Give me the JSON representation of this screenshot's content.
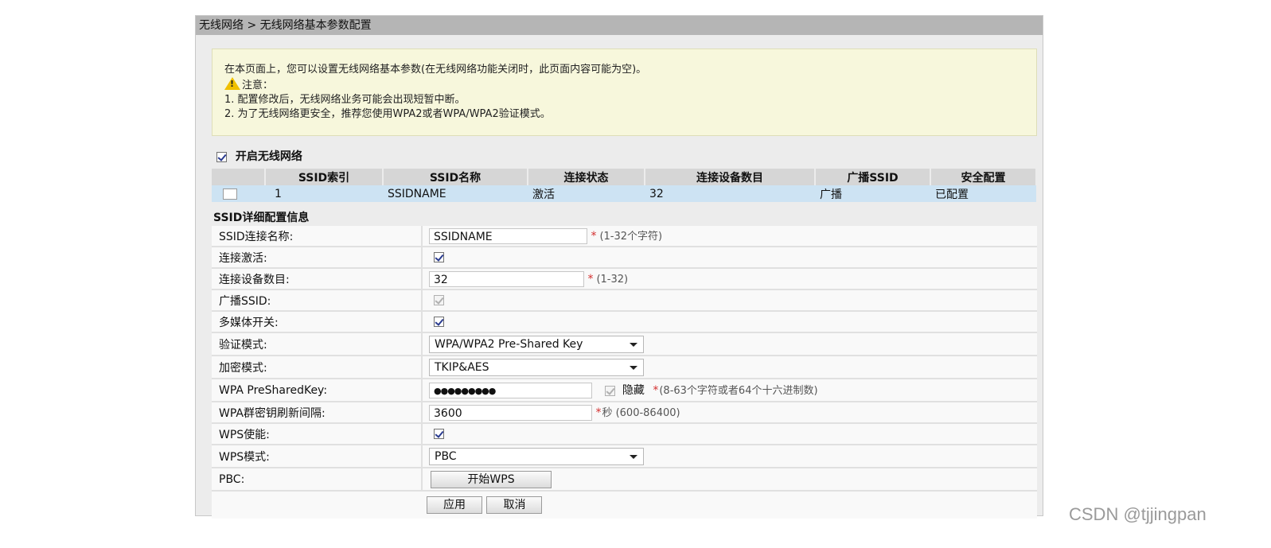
{
  "breadcrumb": "无线网络 > 无线网络基本参数配置",
  "notice": {
    "line1": "在本页面上，您可以设置无线网络基本参数(在无线网络功能关闭时，此页面内容可能为空)。",
    "warning_title": "注意：",
    "item1": "1. 配置修改后，无线网络业务可能会出现短暂中断。",
    "item2": "2. 为了无线网络更安全，推荐您使用WPA2或者WPA/WPA2验证模式。"
  },
  "enable_wireless": {
    "label": "开启无线网络",
    "checked": true
  },
  "ssid_table": {
    "headers": [
      "",
      "SSID索引",
      "SSID名称",
      "连接状态",
      "连接设备数目",
      "广播SSID",
      "安全配置"
    ],
    "rows": [
      {
        "index": "1",
        "name": "SSIDNAME",
        "status": "激活",
        "devices": "32",
        "broadcast": "广播",
        "security": "已配置"
      }
    ]
  },
  "details": {
    "title": "SSID详细配置信息",
    "ssid_name": {
      "label": "SSID连接名称:",
      "value": "SSIDNAME",
      "hint": "(1-32个字符)"
    },
    "connection_active": {
      "label": "连接激活:",
      "checked": true
    },
    "device_count": {
      "label": "连接设备数目:",
      "value": "32",
      "hint": "(1-32)"
    },
    "broadcast_ssid": {
      "label": "广播SSID:",
      "checked": true,
      "disabled": true
    },
    "multimedia": {
      "label": "多媒体开关:",
      "checked": true
    },
    "auth_mode": {
      "label": "验证模式:",
      "value": "WPA/WPA2 Pre-Shared Key"
    },
    "encryption": {
      "label": "加密模式:",
      "value": "TKIP&AES"
    },
    "psk": {
      "label": "WPA PreSharedKey:",
      "value": "●●●●●●●●●",
      "hide_label": "隐藏",
      "hint": "(8-63个字符或者64个十六进制数)"
    },
    "rekey": {
      "label": "WPA群密钥刷新间隔:",
      "value": "3600",
      "hint": "秒 (600-86400)"
    },
    "wps_enable": {
      "label": "WPS使能:",
      "checked": true
    },
    "wps_mode": {
      "label": "WPS模式:",
      "value": "PBC"
    },
    "pbc": {
      "label": "PBC:",
      "button": "开始WPS"
    }
  },
  "actions": {
    "apply": "应用",
    "cancel": "取消"
  },
  "required_mark": "*",
  "watermark": "CSDN @tjjingpan",
  "colors": {
    "header_bar": "#b5b5b5",
    "notice_bg": "#f7f7dc",
    "selected_row": "#cde3f3",
    "required": "#d32f2f"
  }
}
